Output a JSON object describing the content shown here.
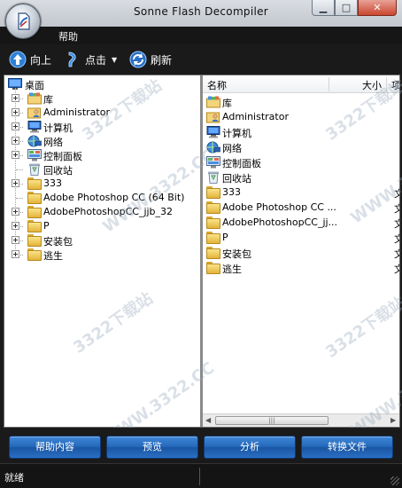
{
  "window": {
    "title": "Sonne Flash Decompiler",
    "min_glyph": "▁",
    "max_glyph": "□",
    "close_glyph": "✕"
  },
  "menu": {
    "help": "帮助"
  },
  "toolbar": {
    "up": "向上",
    "click": "点击",
    "refresh": "刷新",
    "dropdown_glyph": "▼"
  },
  "tree": {
    "root": "桌面",
    "items": [
      {
        "label": "库",
        "icon": "library-icon",
        "expandable": true
      },
      {
        "label": "Administrator",
        "icon": "user-folder-icon",
        "expandable": true
      },
      {
        "label": "计算机",
        "icon": "computer-icon",
        "expandable": true
      },
      {
        "label": "网络",
        "icon": "network-icon",
        "expandable": true
      },
      {
        "label": "控制面板",
        "icon": "control-panel-icon",
        "expandable": true
      },
      {
        "label": "回收站",
        "icon": "recycle-bin-icon",
        "expandable": false
      },
      {
        "label": "333",
        "icon": "folder-icon",
        "expandable": true
      },
      {
        "label": "Adobe Photoshop CC (64 Bit)",
        "icon": "folder-icon",
        "expandable": false
      },
      {
        "label": "AdobePhotoshopCC_jjb_32",
        "icon": "folder-icon",
        "expandable": true
      },
      {
        "label": "P",
        "icon": "folder-icon",
        "expandable": true
      },
      {
        "label": "安装包",
        "icon": "folder-icon",
        "expandable": true
      },
      {
        "label": "逃生",
        "icon": "folder-icon",
        "expandable": true
      }
    ]
  },
  "list": {
    "columns": {
      "name": "名称",
      "size": "大小",
      "type": "项"
    },
    "rows": [
      {
        "name": "库",
        "icon": "library-icon",
        "type": ""
      },
      {
        "name": "Administrator",
        "icon": "user-folder-icon",
        "type": ""
      },
      {
        "name": "计算机",
        "icon": "computer-icon",
        "type": ""
      },
      {
        "name": "网络",
        "icon": "network-icon",
        "type": ""
      },
      {
        "name": "控制面板",
        "icon": "control-panel-icon",
        "type": ""
      },
      {
        "name": "回收站",
        "icon": "recycle-bin-icon",
        "type": ""
      },
      {
        "name": "333",
        "icon": "folder-icon",
        "type": "文"
      },
      {
        "name": "Adobe Photoshop CC ...",
        "icon": "folder-icon",
        "type": "文"
      },
      {
        "name": "AdobePhotoshopCC_jj...",
        "icon": "folder-icon",
        "type": "文"
      },
      {
        "name": "P",
        "icon": "folder-icon",
        "type": "文"
      },
      {
        "name": "安装包",
        "icon": "folder-icon",
        "type": "文"
      },
      {
        "name": "逃生",
        "icon": "folder-icon",
        "type": "文"
      }
    ],
    "scroll_left": "◀",
    "scroll_right": "▶",
    "thumb_grip": "|||"
  },
  "buttons": {
    "help_content": "帮助内容",
    "preview": "预览",
    "analyze": "分析",
    "convert": "转换文件"
  },
  "status": {
    "text": "就绪"
  },
  "watermark": {
    "text1": "3322下载站",
    "text2": "WWW.3322.CC"
  },
  "colors": {
    "button_blue": "#2a6fc4",
    "toolbar_bg": "#1a1a1a",
    "window_bg": "#ffffff"
  }
}
